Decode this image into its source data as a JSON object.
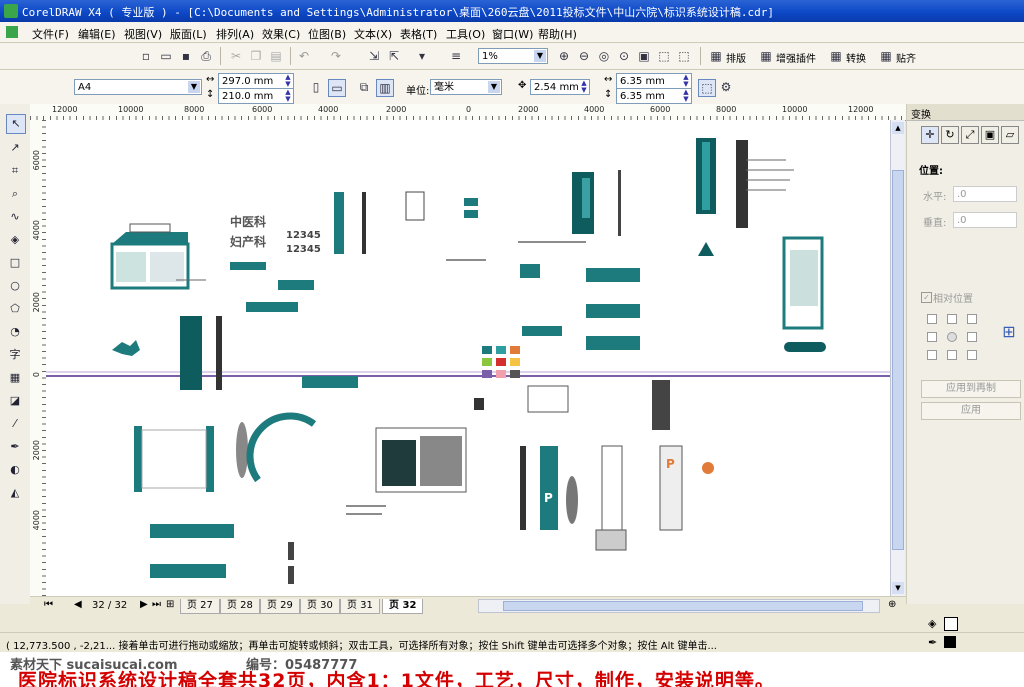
{
  "window": {
    "title": "CorelDRAW X4 ( 专业版 ) - [C:\\Documents and Settings\\Administrator\\桌面\\260云盘\\2011投标文件\\中山六院\\标识系统设计稿.cdr]"
  },
  "menu": [
    "文件(F)",
    "编辑(E)",
    "视图(V)",
    "版面(L)",
    "排列(A)",
    "效果(C)",
    "位图(B)",
    "文本(X)",
    "表格(T)",
    "工具(O)",
    "窗口(W)",
    "帮助(H)"
  ],
  "toolbar": {
    "zoom_value": "1%",
    "buttons": [
      "排版",
      "增强插件",
      "转换",
      "贴齐"
    ]
  },
  "propbar": {
    "paper": "A4",
    "width": "297.0 mm",
    "height": "210.0 mm",
    "unit_label": "单位:",
    "unit_value": "毫米",
    "nudge": "2.54 mm",
    "dup_x": "6.35 mm",
    "dup_y": "6.35 mm"
  },
  "ruler_h": [
    "12000",
    "10000",
    "8000",
    "6000",
    "4000",
    "2000",
    "0",
    "2000",
    "4000",
    "6000",
    "8000",
    "10000",
    "12000"
  ],
  "ruler_v": [
    "6000",
    "4000",
    "2000",
    "0",
    "2000",
    "4000"
  ],
  "pages": {
    "counter": "32 / 32",
    "tabs": [
      "页 27",
      "页 28",
      "页 29",
      "页 30",
      "页 31",
      "页 32"
    ],
    "active": "页 32"
  },
  "docker": {
    "title": "变换",
    "position_label": "位置:",
    "h_label": "水平:",
    "h_value": ".0",
    "v_label": "垂直:",
    "v_value": ".0",
    "relative_label": "相对位置",
    "apply_copy": "应用到再制",
    "apply": "应用"
  },
  "status": {
    "text": "( 12,773.500 , -2,21...    接着单击可进行拖动或缩放；再单击可旋转或倾斜；双击工具，可选择所有对象；按住 Shift 键单击可选择多个对象；按住 Alt 键单击..."
  },
  "watermark": {
    "site": "素材天下 sucaisucai.com",
    "code": "编号：05487777",
    "caption": "医院标识系统设计稿全套共32页，内含1：1文件，工艺，尺寸，制作，安装说明等。"
  },
  "colors": {
    "teal": "#1d7b7e",
    "caption_red": "#d40000"
  }
}
